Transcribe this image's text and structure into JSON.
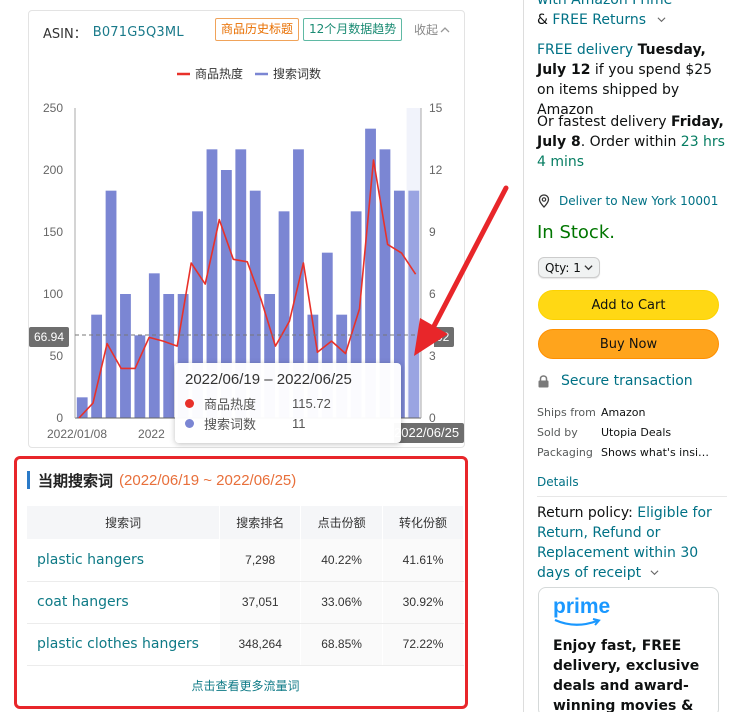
{
  "product_panel": {
    "asin_label": "ASIN：",
    "asin_value": "B071G5Q3ML",
    "tag_history_title": "商品历史标题",
    "tag_trend": "12个月数据趋势",
    "collapse_label": "收起"
  },
  "chart_data": {
    "type": "bar",
    "legend_position": "top-center",
    "grid": false,
    "series": [
      {
        "name": "商品热度",
        "kind": "line",
        "axis": "left",
        "color": "#e8312a",
        "values": [
          0,
          12,
          60,
          40,
          40,
          65,
          62,
          58,
          125,
          108,
          160,
          128,
          126,
          95,
          58,
          78,
          125,
          53,
          62,
          52,
          88,
          208,
          140,
          133,
          116
        ]
      },
      {
        "name": "搜索词数",
        "kind": "bar",
        "axis": "right",
        "color": "#7b86d3",
        "values": [
          1,
          5,
          11,
          6,
          4,
          7,
          6,
          6,
          10,
          13,
          12,
          13,
          11,
          6,
          10,
          13,
          5,
          8,
          5,
          10,
          14,
          13,
          11,
          11
        ]
      }
    ],
    "x_labels": [
      "2022/01/08",
      "2022",
      "",
      "",
      "2022/06/25"
    ],
    "y_left": {
      "ticks": [
        "0",
        "50",
        "100",
        "150",
        "200",
        "250"
      ],
      "range": [
        0,
        250
      ]
    },
    "y_right": {
      "ticks": [
        "0",
        "3",
        "6",
        "9",
        "12",
        "15"
      ],
      "range": [
        0,
        15
      ]
    },
    "hover": {
      "left_value_label": "66.94",
      "right_value_label": "4.02",
      "x_label": "2022/06/25",
      "highlight_index": 23
    },
    "tooltip": {
      "title": "2022/06/19 – 2022/06/25",
      "rows": [
        {
          "name": "商品热度",
          "value": "115.72",
          "color": "#e8312a"
        },
        {
          "name": "搜索词数",
          "value": "11",
          "color": "#7b86d3"
        }
      ]
    }
  },
  "search_terms": {
    "title": "当期搜索词",
    "range": "(2022/06/19 ~ 2022/06/25)",
    "columns": [
      "搜索词",
      "搜索排名",
      "点击份额",
      "转化份额"
    ],
    "rows": [
      [
        "plastic hangers",
        "7,298",
        "40.22%",
        "41.61%"
      ],
      [
        "coat hangers",
        "37,051",
        "33.06%",
        "30.92%"
      ],
      [
        "plastic clothes hangers",
        "348,264",
        "68.85%",
        "72.22%"
      ]
    ],
    "more_link": "点击查看更多流量词"
  },
  "buybox": {
    "top_line1": "with Amazon Prime",
    "top_line2_prefix": "& ",
    "top_line2_link": "FREE Returns",
    "free_delivery": {
      "link": "FREE delivery",
      "date": "Tuesday, July 12",
      "rest": " if you spend $25 on items shipped by Amazon"
    },
    "fastest": {
      "prefix": "Or fastest delivery ",
      "date": "Friday, July 8",
      "mid": ". Order within ",
      "countdown": "23 hrs 4 mins"
    },
    "deliver_to": "Deliver to New York 10001",
    "stock": "In Stock.",
    "qty": "Qty: 1",
    "add_to_cart": "Add to Cart",
    "buy_now": "Buy Now",
    "secure": "Secure transaction",
    "info": [
      {
        "k": "Ships from",
        "v": "Amazon",
        "link": false
      },
      {
        "k": "Sold by",
        "v": "Utopia Deals",
        "link": true
      },
      {
        "k": "Packaging",
        "v": "Shows what's insi…",
        "link": false
      }
    ],
    "details": "Details",
    "return_policy_label": "Return policy: ",
    "return_policy_link": "Eligible for Return, Refund or Replacement within 30 days of receipt",
    "prime_logo": "prime",
    "prime_text": "Enjoy fast, FREE delivery, exclusive deals and award-winning movies & TV"
  },
  "colors": {
    "accent_red": "#e8262a",
    "teal_link": "#007185",
    "cart_yellow": "#ffd814",
    "buy_orange": "#ffa41c"
  }
}
